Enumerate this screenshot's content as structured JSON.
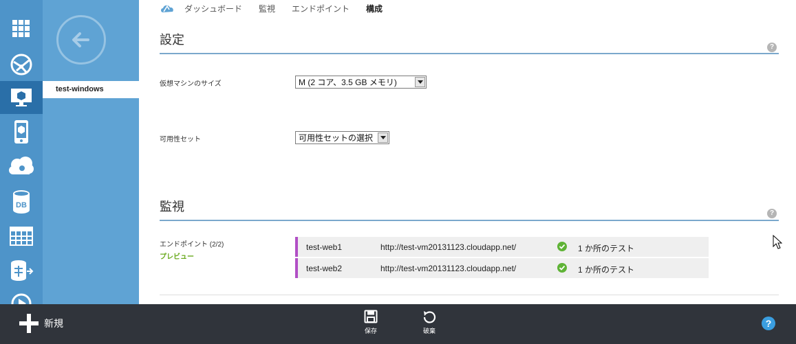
{
  "nav": {
    "tabs": [
      "ダッシュボード",
      "監視",
      "エンドポイント",
      "構成"
    ],
    "active_tab": "構成"
  },
  "panel": {
    "selected_item": "test-windows"
  },
  "rail": {
    "icons": [
      "all-items-icon",
      "websites-icon",
      "virtual-machines-icon",
      "mobile-services-icon",
      "cloud-services-icon",
      "sql-databases-icon",
      "storage-icon",
      "hdinsight-icon",
      "media-services-icon"
    ]
  },
  "settings": {
    "title": "設定",
    "vm_size_label": "仮想マシンのサイズ",
    "vm_size_value": "M (2 コア、3.5 GB メモリ)",
    "availability_set_label": "可用性セット",
    "availability_set_value": "可用性セットの選択"
  },
  "monitoring": {
    "title": "監視",
    "endpoints_label": "エンドポイント (2/2)",
    "preview_label": "プレビュー",
    "endpoints": [
      {
        "name": "test-web1",
        "url": "http://test-vm20131123.cloudapp.net/",
        "status": "1 か所のテスト"
      },
      {
        "name": "test-web2",
        "url": "http://test-vm20131123.cloudapp.net/",
        "status": "1 か所のテスト"
      }
    ]
  },
  "commandbar": {
    "new_label": "新規",
    "save_label": "保存",
    "discard_label": "破棄",
    "help_label": "?"
  },
  "colors": {
    "rail": "#4e94c9",
    "panel": "#5fa3d4",
    "active_rail": "#2a6fa8",
    "endpoint_accent": "#b14fc5",
    "ok_green": "#5fb336",
    "bottombar": "#30343b"
  }
}
